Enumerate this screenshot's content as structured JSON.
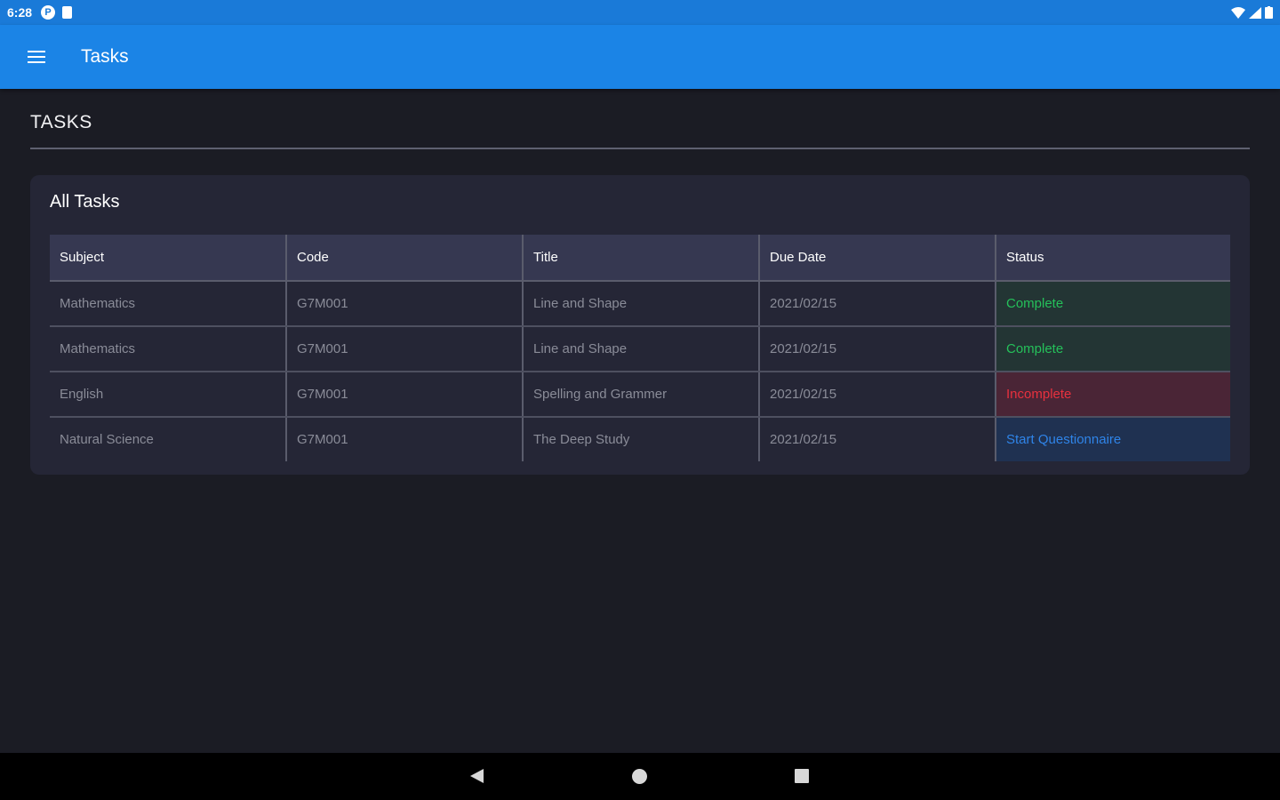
{
  "status_bar": {
    "time": "6:28",
    "icon1": "P"
  },
  "app_bar": {
    "title": "Tasks"
  },
  "page": {
    "heading": "TASKS"
  },
  "card": {
    "title": "All Tasks",
    "columns": [
      "Subject",
      "Code",
      "Title",
      "Due Date",
      "Status"
    ],
    "rows": [
      {
        "subject": "Mathematics",
        "code": "G7M001",
        "title": "Line and Shape",
        "due": "2021/02/15",
        "status": "Complete"
      },
      {
        "subject": "Mathematics",
        "code": "G7M001",
        "title": "Line and Shape",
        "due": "2021/02/15",
        "status": "Complete"
      },
      {
        "subject": "English",
        "code": "G7M001",
        "title": "Spelling and Grammer",
        "due": "2021/02/15",
        "status": "Incomplete"
      },
      {
        "subject": "Natural Science",
        "code": "G7M001",
        "title": "The Deep Study",
        "due": "2021/02/15",
        "status": "Start Questionnaire"
      }
    ]
  },
  "colors": {
    "app_bar": "#1b84e6",
    "complete": "#25c05a",
    "incomplete": "#e8313e",
    "start": "#2f84e8"
  }
}
